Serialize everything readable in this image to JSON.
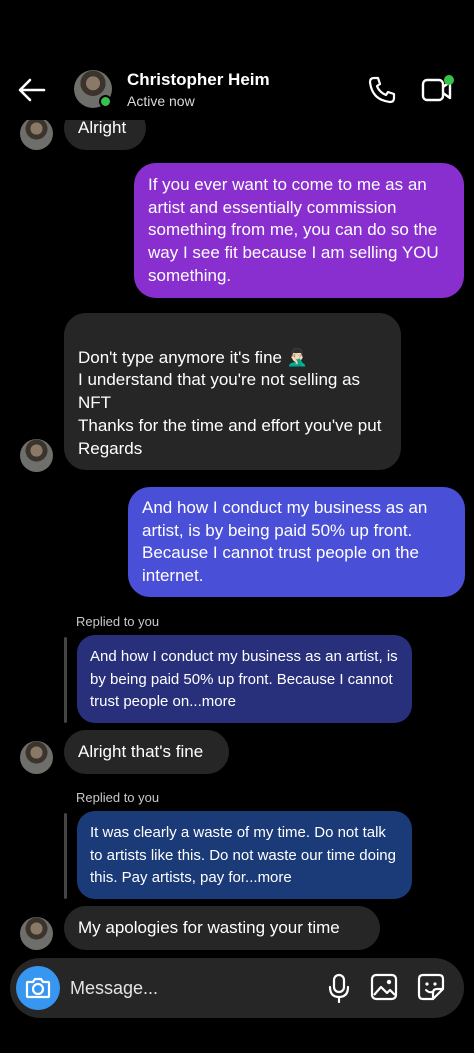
{
  "header": {
    "name": "Christopher Heim",
    "status": "Active now"
  },
  "icons": {
    "back": "back-arrow-icon",
    "call": "phone-icon",
    "video": "video-call-icon",
    "camera": "camera-icon",
    "mic": "microphone-icon",
    "gallery": "gallery-icon",
    "sticker": "sticker-icon"
  },
  "messages": {
    "m1": "Alright",
    "m2": "If you ever want to come to me as an artist and essentially commission something from me, you can do so the way I see fit because I am selling YOU something.",
    "m3": "Don't type anymore it's fine 🤦🏻‍♂️\nI understand that you're not selling as NFT\nThanks for the time and effort you've put\nRegards",
    "m4": "And how I conduct my business as an artist, is by being paid 50% up front. Because I cannot trust people on the internet.",
    "reply1_label": "Replied to you",
    "reply1_quote": "And how I conduct my business as an artist, is by being paid 50% up front. Because I cannot trust people on...more",
    "m5": "Alright that's fine",
    "reply2_label": "Replied to you",
    "reply2_quote": "It was clearly a waste of my time. Do not talk to artists like this. Do not waste our time doing this. Pay artists, pay for...more",
    "m6": "My apologies for wasting your time"
  },
  "composer": {
    "placeholder": "Message..."
  },
  "colors": {
    "background": "#000000",
    "received_bubble": "#262626",
    "sent_gradient_top": "#8a2fcf",
    "sent_gradient_bottom": "#4a4fd8",
    "reply_quote": "#1e2a66",
    "camera_button": "#3797f0",
    "online": "#37c34b"
  }
}
